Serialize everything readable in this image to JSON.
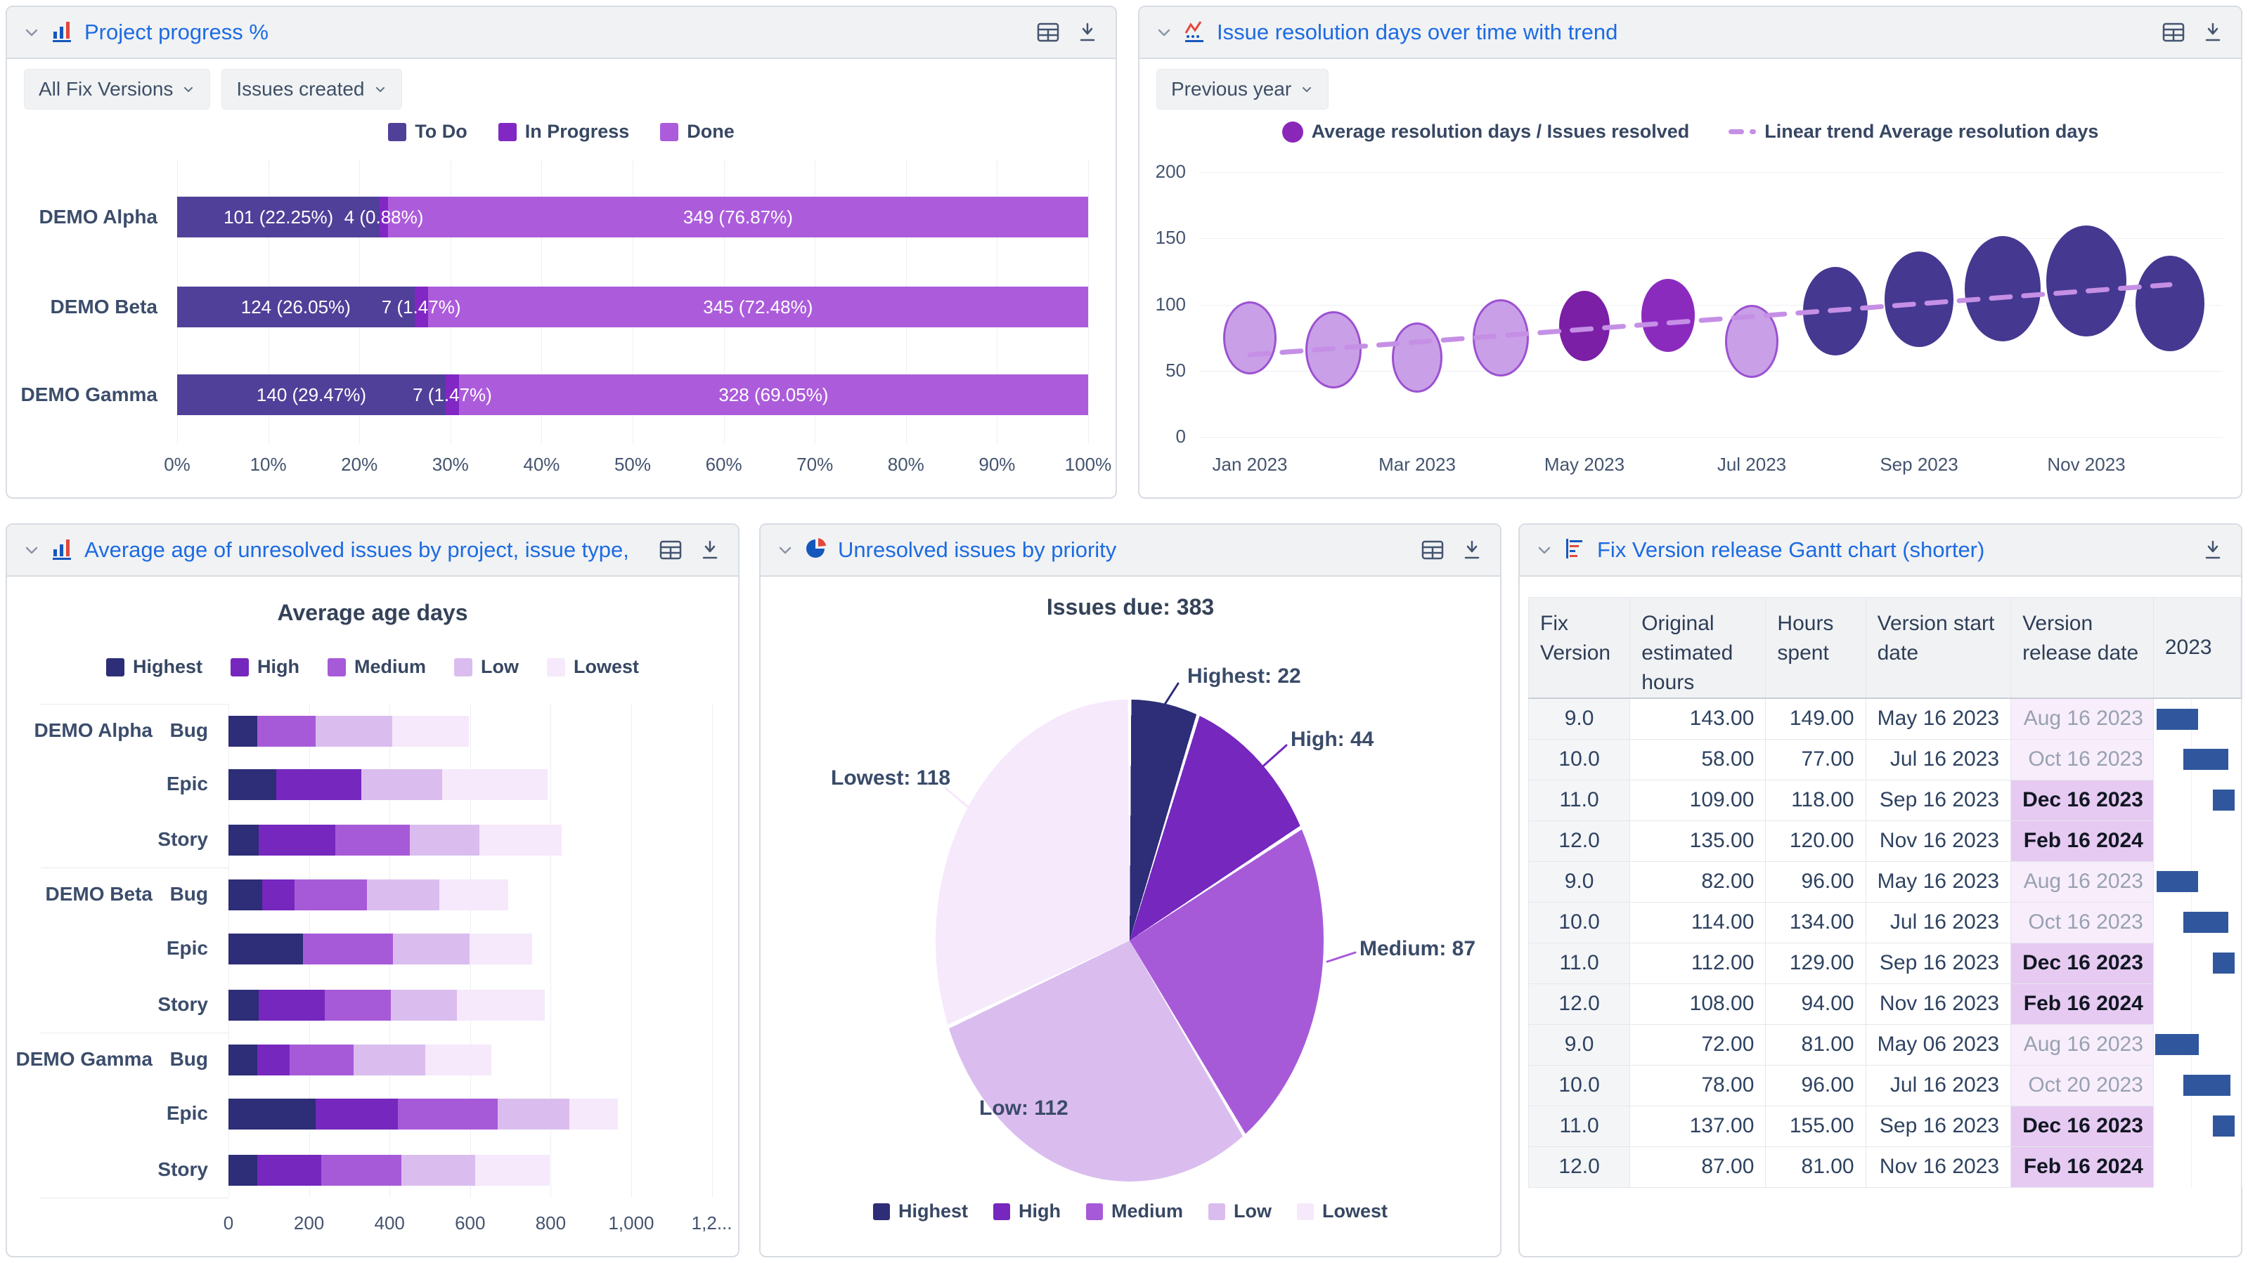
{
  "colors": {
    "accent_blue": "#1C6BE2",
    "icon_gray": "#44546F",
    "header_bg": "#F1F2F4",
    "panel_border": "#D8DCE3",
    "gridline": "#EDEFF3",
    "gantt_bar": "#30579E",
    "todo": "#514099",
    "in_progress": "#8227C4",
    "done": "#AC5CDB",
    "priority_highest": "#2D2D78",
    "priority_high": "#7527BE",
    "priority_medium": "#A75AD8",
    "priority_low": "#DABDEE",
    "priority_lowest": "#F5E9FB"
  },
  "icons": {
    "collapse": "chevron-down-icon",
    "bar_chart": "bar-chart-icon",
    "line_chart": "line-chart-icon",
    "pie_chart": "pie-chart-icon",
    "gantt": "gantt-chart-icon",
    "table_view": "table-view-icon",
    "download": "download-icon"
  },
  "panels": {
    "progress": {
      "title": "Project progress %",
      "filters": [
        {
          "label": "All Fix Versions"
        },
        {
          "label": "Issues created"
        }
      ]
    },
    "resolution": {
      "title": "Issue resolution days over time with trend",
      "filters": [
        {
          "label": "Previous year"
        }
      ],
      "legend": [
        "Average resolution days / Issues resolved",
        "Linear trend Average resolution days"
      ]
    },
    "age": {
      "title": "Average age of unresolved issues by project, issue type, and p..."
    },
    "pie": {
      "title": "Unresolved issues by priority"
    },
    "gantt": {
      "title": "Fix Version release Gantt chart (shorter)"
    }
  },
  "chart_data": [
    {
      "id": "progress",
      "type": "bar",
      "stacked": true,
      "orientation": "horizontal",
      "title": "Project progress %",
      "categories": [
        "DEMO Alpha",
        "DEMO Beta",
        "DEMO Gamma"
      ],
      "series": [
        {
          "name": "To Do",
          "color": "#514099",
          "values": [
            101,
            124,
            140
          ],
          "pcts": [
            22.25,
            26.05,
            29.47
          ]
        },
        {
          "name": "In Progress",
          "color": "#8227C4",
          "values": [
            4,
            7,
            7
          ],
          "pcts": [
            0.88,
            1.47,
            1.47
          ]
        },
        {
          "name": "Done",
          "color": "#AC5CDB",
          "values": [
            349,
            345,
            328
          ],
          "pcts": [
            76.87,
            72.48,
            69.05
          ]
        }
      ],
      "labels": [
        [
          "101 (22.25%)",
          "4 (0.88%)",
          "349 (76.87%)"
        ],
        [
          "124 (26.05%)",
          "7 (1.47%)",
          "345 (72.48%)"
        ],
        [
          "140 (29.47%)",
          "7 (1.47%)",
          "328 (69.05%)"
        ]
      ],
      "x_ticks": [
        "0%",
        "10%",
        "20%",
        "30%",
        "40%",
        "50%",
        "60%",
        "70%",
        "80%",
        "90%",
        "100%"
      ],
      "xlim": [
        0,
        100
      ]
    },
    {
      "id": "resolution",
      "type": "scatter",
      "subtype": "bubble",
      "title": "Issue resolution days over time with trend",
      "ylim": [
        0,
        200
      ],
      "y_ticks": [
        "200",
        "150",
        "100",
        "50",
        "0"
      ],
      "x_ticks": [
        "Jan 2023",
        "Mar 2023",
        "May 2023",
        "Jul 2023",
        "Sep 2023",
        "Nov 2023"
      ],
      "points": [
        {
          "month": "Jan 2023",
          "value": 75,
          "r": 38,
          "fill": "#C9A0E7",
          "stroke": "#9C51D1"
        },
        {
          "month": "Feb 2023",
          "value": 66,
          "r": 40,
          "fill": "#C9A0E7",
          "stroke": "#9C51D1"
        },
        {
          "month": "Mar 2023",
          "value": 60,
          "r": 36,
          "fill": "#C9A0E7",
          "stroke": "#9C51D1"
        },
        {
          "month": "Apr 2023",
          "value": 75,
          "r": 40,
          "fill": "#C9A0E7",
          "stroke": "#9C51D1"
        },
        {
          "month": "May 2023",
          "value": 84,
          "r": 36,
          "fill": "#7B1FA6",
          "stroke": "#7B1FA6"
        },
        {
          "month": "Jun 2023",
          "value": 92,
          "r": 38,
          "fill": "#8B2BBE",
          "stroke": "#8B2BBE"
        },
        {
          "month": "Jul 2023",
          "value": 72,
          "r": 38,
          "fill": "#C9A0E7",
          "stroke": "#9C51D1"
        },
        {
          "month": "Aug 2023",
          "value": 95,
          "r": 46,
          "fill": "#453891",
          "stroke": "#453891"
        },
        {
          "month": "Sep 2023",
          "value": 104,
          "r": 49,
          "fill": "#453891",
          "stroke": "#453891"
        },
        {
          "month": "Oct 2023",
          "value": 112,
          "r": 54,
          "fill": "#453891",
          "stroke": "#453891"
        },
        {
          "month": "Nov 2023",
          "value": 118,
          "r": 57,
          "fill": "#453891",
          "stroke": "#453891"
        },
        {
          "month": "Dec 2023",
          "value": 101,
          "r": 49,
          "fill": "#453891",
          "stroke": "#453891"
        }
      ],
      "trend": {
        "name": "Linear trend Average resolution days",
        "start_value": 62,
        "end_value": 115,
        "color": "#C58FE6"
      },
      "legend_marker_color": "#8B27B8"
    },
    {
      "id": "age",
      "type": "bar",
      "stacked": true,
      "orientation": "horizontal",
      "title": "Average age days",
      "series_names": [
        "Highest",
        "High",
        "Medium",
        "Low",
        "Lowest"
      ],
      "colors": [
        "#2D2D78",
        "#7527BE",
        "#A75AD8",
        "#DABDEE",
        "#F5E9FB"
      ],
      "x_ticks": [
        "0",
        "200",
        "400",
        "600",
        "800",
        "1,000",
        "1,2..."
      ],
      "xlim": [
        0,
        1200
      ],
      "rows": [
        {
          "project": "DEMO Alpha",
          "type": "Bug",
          "values": [
            71,
            0,
            145,
            190,
            191
          ]
        },
        {
          "project": "",
          "type": "Epic",
          "values": [
            119,
            211,
            0,
            200,
            262
          ]
        },
        {
          "project": "",
          "type": "Story",
          "values": [
            75,
            190,
            185,
            173,
            205
          ]
        },
        {
          "project": "DEMO Beta",
          "type": "Bug",
          "values": [
            83,
            81,
            179,
            181,
            170
          ]
        },
        {
          "project": "",
          "type": "Epic",
          "values": [
            185,
            0,
            224,
            190,
            155
          ]
        },
        {
          "project": "",
          "type": "Story",
          "values": [
            75,
            164,
            165,
            164,
            218
          ]
        },
        {
          "project": "DEMO Gamma",
          "type": "Bug",
          "values": [
            72,
            80,
            159,
            177,
            164
          ]
        },
        {
          "project": "",
          "type": "Epic",
          "values": [
            217,
            203,
            248,
            179,
            119
          ]
        },
        {
          "project": "",
          "type": "Story",
          "values": [
            72,
            158,
            200,
            183,
            184
          ]
        }
      ]
    },
    {
      "id": "priority-pie",
      "type": "pie",
      "title": "Issues due: 383",
      "total": 383,
      "colors": [
        "#2D2D78",
        "#7527BE",
        "#A75AD8",
        "#DABDEE",
        "#F5E9FB"
      ],
      "slices": [
        {
          "label": "Highest",
          "value": 22
        },
        {
          "label": "High",
          "value": 44
        },
        {
          "label": "Medium",
          "value": 87
        },
        {
          "label": "Low",
          "value": 112
        },
        {
          "label": "Lowest",
          "value": 118
        }
      ],
      "legend": [
        "Highest",
        "High",
        "Medium",
        "Low",
        "Lowest"
      ]
    },
    {
      "id": "gantt",
      "type": "table",
      "columns": [
        "Fix Version",
        "Original estimated hours",
        "Hours spent",
        "Version start date",
        "Version release date",
        "2023"
      ],
      "rows": [
        {
          "fix": "9.0",
          "est": "143.00",
          "spent": "149.00",
          "start": "May 16 2023",
          "release": "Aug 16 2023",
          "status": "released",
          "bar": {
            "left": 3,
            "width": 48
          }
        },
        {
          "fix": "10.0",
          "est": "58.00",
          "spent": "77.00",
          "start": "Jul 16 2023",
          "release": "Oct 16 2023",
          "status": "released",
          "bar": {
            "left": 34,
            "width": 52
          }
        },
        {
          "fix": "11.0",
          "est": "109.00",
          "spent": "118.00",
          "start": "Sep 16 2023",
          "release": "Dec 16 2023",
          "status": "upcoming",
          "bar": {
            "left": 68,
            "width": 25
          }
        },
        {
          "fix": "12.0",
          "est": "135.00",
          "spent": "120.00",
          "start": "Nov 16 2023",
          "release": "Feb 16 2024",
          "status": "upcoming",
          "bar": null
        },
        {
          "fix": "9.0",
          "est": "82.00",
          "spent": "96.00",
          "start": "May 16 2023",
          "release": "Aug 16 2023",
          "status": "released",
          "bar": {
            "left": 3,
            "width": 48
          }
        },
        {
          "fix": "10.0",
          "est": "114.00",
          "spent": "134.00",
          "start": "Jul 16 2023",
          "release": "Oct 16 2023",
          "status": "released",
          "bar": {
            "left": 34,
            "width": 52
          }
        },
        {
          "fix": "11.0",
          "est": "112.00",
          "spent": "129.00",
          "start": "Sep 16 2023",
          "release": "Dec 16 2023",
          "status": "upcoming",
          "bar": {
            "left": 68,
            "width": 25
          }
        },
        {
          "fix": "12.0",
          "est": "108.00",
          "spent": "94.00",
          "start": "Nov 16 2023",
          "release": "Feb 16 2024",
          "status": "upcoming",
          "bar": null
        },
        {
          "fix": "9.0",
          "est": "72.00",
          "spent": "81.00",
          "start": "May 06 2023",
          "release": "Aug 16 2023",
          "status": "released",
          "bar": {
            "left": 2,
            "width": 50
          }
        },
        {
          "fix": "10.0",
          "est": "78.00",
          "spent": "96.00",
          "start": "Jul 16 2023",
          "release": "Oct 20 2023",
          "status": "released",
          "bar": {
            "left": 34,
            "width": 54
          }
        },
        {
          "fix": "11.0",
          "est": "137.00",
          "spent": "155.00",
          "start": "Sep 16 2023",
          "release": "Dec 16 2023",
          "status": "upcoming",
          "bar": {
            "left": 68,
            "width": 25
          }
        },
        {
          "fix": "12.0",
          "est": "87.00",
          "spent": "81.00",
          "start": "Nov 16 2023",
          "release": "Feb 16 2024",
          "status": "upcoming",
          "bar": null
        }
      ]
    }
  ]
}
